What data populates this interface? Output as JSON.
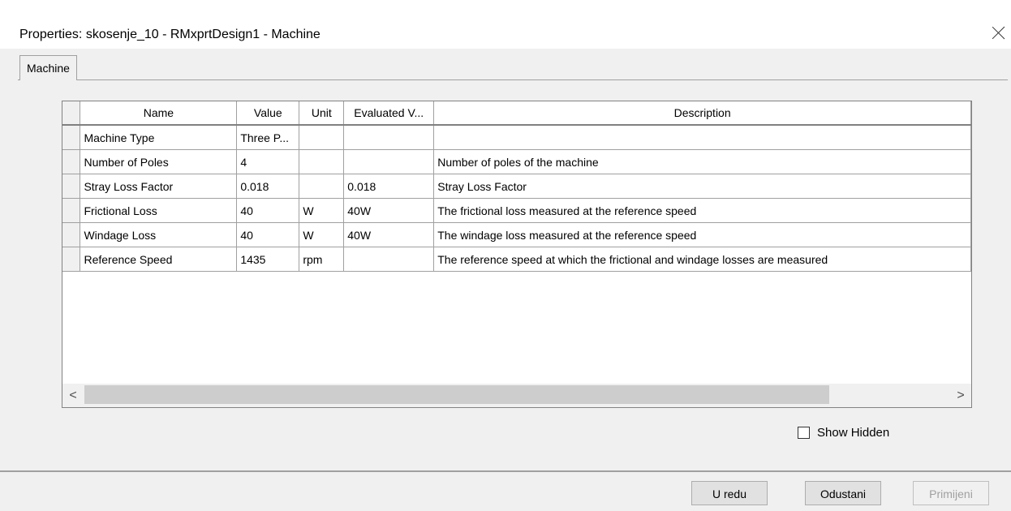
{
  "window": {
    "title": "Properties: skosenje_10 - RMxprtDesign1 - Machine",
    "close_glyph": ""
  },
  "tabs": [
    {
      "label": "Machine",
      "selected": true
    }
  ],
  "table": {
    "columns": [
      "",
      "Name",
      "Value",
      "Unit",
      "Evaluated V...",
      "Description"
    ],
    "rows": [
      {
        "name": "Machine Type",
        "value": "Three P...",
        "unit": "",
        "evaluated": "",
        "description": ""
      },
      {
        "name": "Number of Poles",
        "value": "4",
        "unit": "",
        "evaluated": "",
        "description": "Number of poles of the machine"
      },
      {
        "name": "Stray Loss Factor",
        "value": "0.018",
        "unit": "",
        "evaluated": "0.018",
        "description": "Stray Loss Factor"
      },
      {
        "name": "Frictional Loss",
        "value": "40",
        "unit": "W",
        "evaluated": "40W",
        "description": "The frictional loss measured at the reference speed"
      },
      {
        "name": "Windage Loss",
        "value": "40",
        "unit": "W",
        "evaluated": "40W",
        "description": "The windage loss measured at the reference speed"
      },
      {
        "name": "Reference Speed",
        "value": "1435",
        "unit": "rpm",
        "evaluated": "",
        "description": "The reference speed at which the frictional and windage losses are measured"
      }
    ]
  },
  "scrollbar": {
    "left_arrow": "<",
    "right_arrow": ">"
  },
  "show_hidden": {
    "label": "Show Hidden",
    "checked": false
  },
  "buttons": {
    "ok": "U redu",
    "cancel": "Odustani",
    "apply": "Primijeni"
  }
}
